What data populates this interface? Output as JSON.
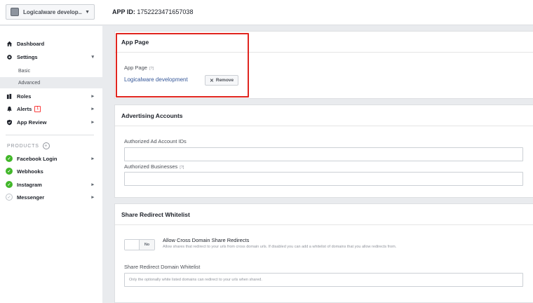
{
  "topbar": {
    "app_name": "Logicalware develop...",
    "app_id_label": "APP ID:",
    "app_id_value": "1752223471657038"
  },
  "sidebar": {
    "dashboard": "Dashboard",
    "settings": "Settings",
    "settings_basic": "Basic",
    "settings_advanced": "Advanced",
    "roles": "Roles",
    "alerts": "Alerts",
    "alerts_badge": "1",
    "app_review": "App Review",
    "products_label": "PRODUCTS",
    "facebook_login": "Facebook Login",
    "webhooks": "Webhooks",
    "instagram": "Instagram",
    "messenger": "Messenger"
  },
  "app_page": {
    "title": "App Page",
    "field_label": "App Page",
    "hint": "[?]",
    "linked_page": "Logicalware development",
    "remove_label": "Remove"
  },
  "advertising": {
    "title": "Advertising Accounts",
    "ad_accounts_label": "Authorized Ad Account IDs",
    "ad_accounts_value": "",
    "businesses_label": "Authorized Businesses",
    "businesses_hint": "[?]",
    "businesses_value": ""
  },
  "share_redirect": {
    "title": "Share Redirect Whitelist",
    "toggle_state": "No",
    "allow_title": "Allow Cross Domain Share Redirects",
    "allow_desc": "Allow shares that redirect to your urls from cross domain urls. If disabled you can add a whitelist of domains that you allow redirects from.",
    "whitelist_label": "Share Redirect Domain Whitelist",
    "whitelist_placeholder": "Only the optionally white listed domains can redirect to your urls when shared."
  },
  "colors": {
    "highlight": "#e0251f",
    "link": "#365899",
    "product_active": "#42b72a"
  }
}
